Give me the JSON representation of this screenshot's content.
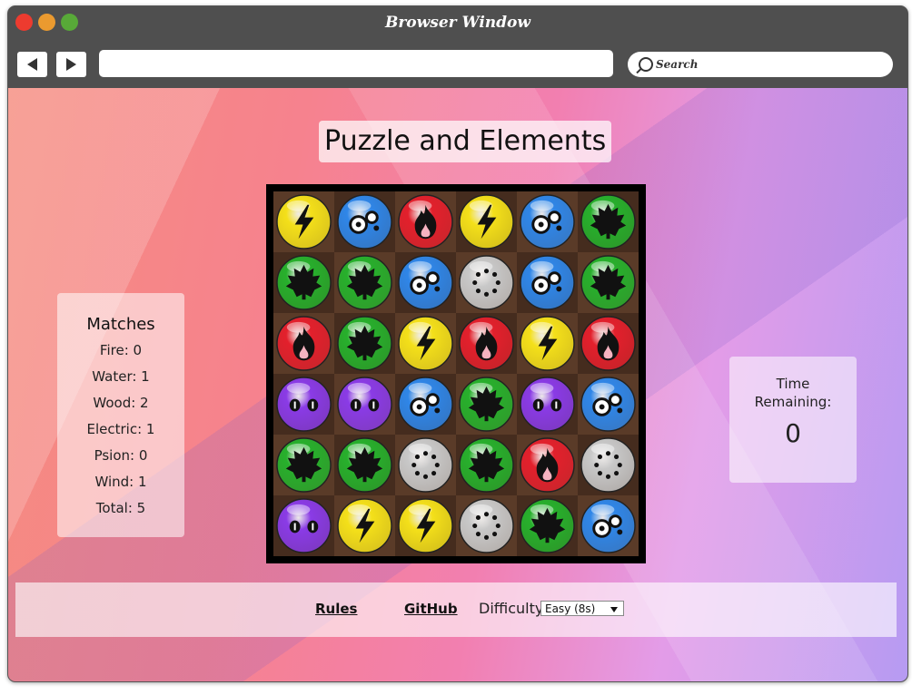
{
  "browser": {
    "title": "Browser Window",
    "search_placeholder": "Search"
  },
  "page": {
    "title": "Puzzle and Elements"
  },
  "board": {
    "grid": [
      [
        "electric",
        "water",
        "fire",
        "electric",
        "water",
        "wood"
      ],
      [
        "wood",
        "wood",
        "water",
        "wind",
        "water",
        "wood"
      ],
      [
        "fire",
        "wood",
        "electric",
        "fire",
        "electric",
        "fire"
      ],
      [
        "psion",
        "psion",
        "water",
        "wood",
        "psion",
        "water"
      ],
      [
        "wood",
        "wood",
        "wind",
        "wood",
        "fire",
        "wind"
      ],
      [
        "psion",
        "electric",
        "electric",
        "wind",
        "wood",
        "water"
      ]
    ]
  },
  "matches": {
    "heading": "Matches",
    "rows": [
      "Fire: 0",
      "Water: 1",
      "Wood: 2",
      "Electric: 1",
      "Psion: 0",
      "Wind: 1",
      "Total: 5"
    ]
  },
  "timer": {
    "label": "Time Remaining:",
    "value": "0"
  },
  "footer": {
    "rules_link": "Rules",
    "github_link": "GitHub",
    "difficulty_label": "Difficulty",
    "difficulty_selected": "Easy (8s)"
  },
  "colors": {
    "fire": "#e3202c",
    "water": "#2f86e8",
    "wood": "#27b02c",
    "electric": "#f4e01a",
    "psion": "#8a3be6",
    "wind": "#c8c8c8"
  }
}
